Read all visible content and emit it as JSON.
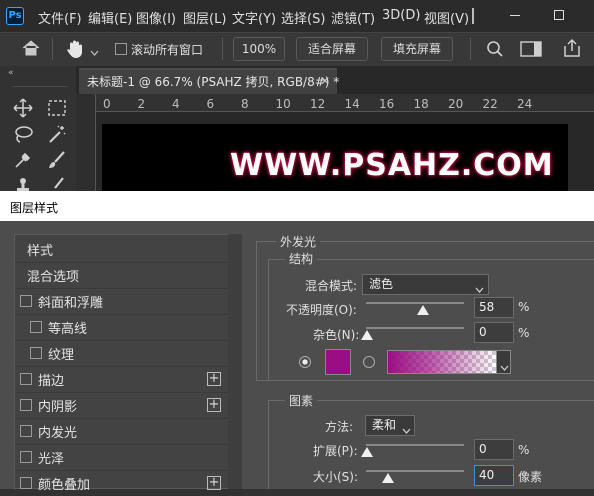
{
  "app": {
    "logo": "Ps"
  },
  "menu": [
    "文件(F)",
    "编辑(E)",
    "图像(I)",
    "图层(L)",
    "文字(Y)",
    "选择(S)",
    "滤镜(T)",
    "3D(D)",
    "视图(V)"
  ],
  "options": {
    "scroll_all": "滚动所有窗口",
    "zoom": "100%",
    "fit_screen": "适合屏幕",
    "fill_screen": "填充屏幕"
  },
  "document": {
    "tab_title": "未标题-1 @ 66.7% (PSAHZ 拷贝, RGB/8#) *",
    "canvas_text": "WWW.PSAHZ.COM",
    "ruler_ticks": [
      "0",
      "2",
      "4",
      "6",
      "8",
      "10",
      "12",
      "14",
      "16",
      "18",
      "20",
      "22",
      "24"
    ]
  },
  "dialog": {
    "title": "图层样式",
    "styles": [
      {
        "label": "样式",
        "checkbox": false,
        "plus": false,
        "indent": false
      },
      {
        "label": "混合选项",
        "checkbox": false,
        "plus": false,
        "indent": false
      },
      {
        "label": "斜面和浮雕",
        "checkbox": true,
        "plus": false,
        "indent": false
      },
      {
        "label": "等高线",
        "checkbox": true,
        "plus": false,
        "indent": true
      },
      {
        "label": "纹理",
        "checkbox": true,
        "plus": false,
        "indent": true
      },
      {
        "label": "描边",
        "checkbox": true,
        "plus": true,
        "indent": false
      },
      {
        "label": "内阴影",
        "checkbox": true,
        "plus": true,
        "indent": false
      },
      {
        "label": "内发光",
        "checkbox": true,
        "plus": false,
        "indent": false
      },
      {
        "label": "光泽",
        "checkbox": true,
        "plus": false,
        "indent": false
      },
      {
        "label": "颜色叠加",
        "checkbox": true,
        "plus": true,
        "indent": false
      }
    ],
    "panel_title": "外发光",
    "structure": {
      "title": "结构",
      "blend_mode_label": "混合模式:",
      "blend_mode_value": "滤色",
      "opacity_label": "不透明度(O):",
      "opacity_value": "58",
      "opacity_unit": "%",
      "noise_label": "杂色(N):",
      "noise_value": "0",
      "noise_unit": "%",
      "glow_color": "#9b0d83"
    },
    "elements": {
      "title": "图素",
      "technique_label": "方法:",
      "technique_value": "柔和",
      "spread_label": "扩展(P):",
      "spread_value": "0",
      "spread_unit": "%",
      "size_label": "大小(S):",
      "size_value": "40",
      "size_unit": "像素"
    }
  }
}
